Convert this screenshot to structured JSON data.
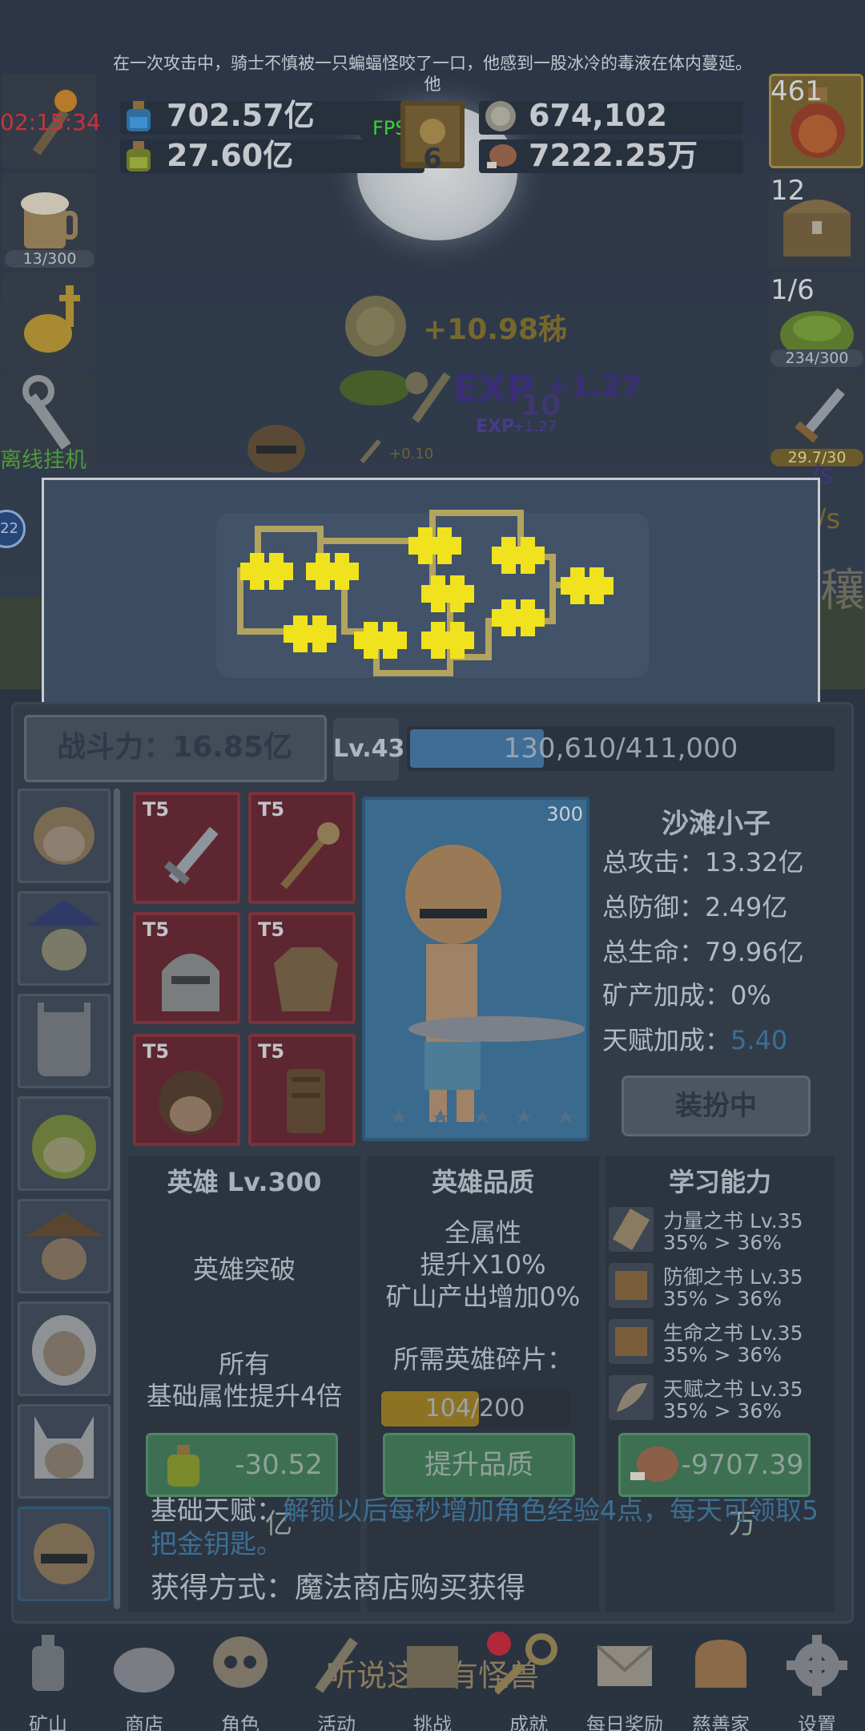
{
  "story": {
    "line1": "在一次攻击中，骑士不慎被一只蝙蝠怪咬了一口，他感到一股冰冷的毒液在体内蔓延。",
    "line2": "他"
  },
  "top": {
    "timer": "02:15:34",
    "fps": "FPS59",
    "potion_blue": "702.57亿",
    "potion_green": "27.60亿",
    "book_count": "6",
    "coin": "674,102",
    "meat": "7222.25万"
  },
  "left_side": {
    "beer_count": "13/300",
    "offline_label": "离线挂机"
  },
  "right_side": {
    "potion_count": "461",
    "chest_count": "12",
    "slime_fraction": "1/6",
    "slime_badge": "234/300",
    "sword_badge": "29.7/30",
    "partial_rate1": "/s",
    "partial_rate2": "/s",
    "partial_glyph": "穰"
  },
  "floaters": {
    "coin_gain": "+10.98秭",
    "exp_big": "EXP",
    "exp_gain": "+1.27",
    "exp_gain_faint": "10",
    "exp_small": "EXP",
    "exp_small_gain": "+1.27",
    "sword_gain": "+0.10"
  },
  "left_bubble": "22",
  "hero_panel": {
    "power": "战斗力：16.85亿",
    "level": "Lv.43",
    "exp_text": "130,610/411,000",
    "exp_fraction": 0.318,
    "portrait_level": "300",
    "equip_tier": "T5",
    "name": "沙滩小子",
    "stats": [
      {
        "label": "总攻击：",
        "value": "13.32亿"
      },
      {
        "label": "总防御：",
        "value": "2.49亿"
      },
      {
        "label": "总生命：",
        "value": "79.96亿"
      },
      {
        "label": "矿产加成：",
        "value": "0%"
      },
      {
        "label": "天赋加成：",
        "value": "5.40"
      }
    ],
    "dress_button": "装扮中"
  },
  "columns": {
    "hero": {
      "title": "英雄 Lv.300",
      "breakthrough": "英雄突破",
      "desc1": "所有",
      "desc2": "基础属性提升4倍",
      "cost": "-30.52亿"
    },
    "quality": {
      "title": "英雄品质",
      "line1": "全属性",
      "line2": "提升X10%",
      "line3": "矿山产出增加0%",
      "frag_label": "所需英雄碎片：",
      "frag_text": "104/200",
      "frag_fraction": 0.52,
      "button": "提升品质"
    },
    "learn": {
      "title": "学习能力",
      "books": [
        {
          "name": "力量之书 Lv.35",
          "val": "35% > 36%"
        },
        {
          "name": "防御之书 Lv.35",
          "val": "35% > 36%"
        },
        {
          "name": "生命之书 Lv.35",
          "val": "35% > 36%"
        },
        {
          "name": "天赋之书 Lv.35",
          "val": "35% > 36%"
        }
      ],
      "cost": "-9707.39万"
    }
  },
  "talent": {
    "label": "基础天赋：",
    "text": "解锁以后每秒增加角色经验4点，每天可领取5把金钥匙。",
    "obtain": "获得方式：魔法商店购买获得"
  },
  "nav": {
    "banner": "听说这里有怪兽",
    "items": [
      "矿山",
      "商店",
      "角色",
      "活动",
      "挑战",
      "成就",
      "每日奖励",
      "慈善家",
      "设置"
    ]
  },
  "colors": {
    "accent_blue": "#3c6f93",
    "fps_green": "#39d23a",
    "timer_red": "#c8323c",
    "equip_red": "#5e2630",
    "map_yellow": "#f0e21c"
  }
}
